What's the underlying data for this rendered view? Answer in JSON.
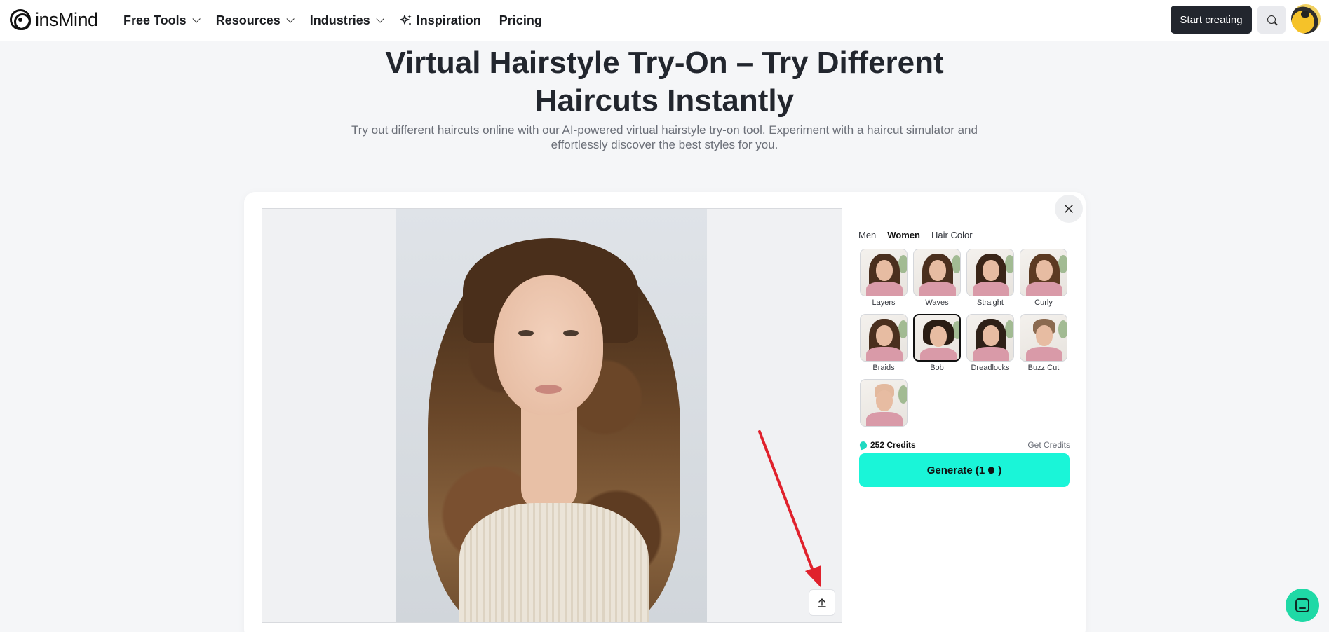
{
  "nav": {
    "brand": "insMind",
    "links": [
      {
        "label": "Free Tools",
        "has_dropdown": true
      },
      {
        "label": "Resources",
        "has_dropdown": true
      },
      {
        "label": "Industries",
        "has_dropdown": true
      },
      {
        "label": "Inspiration",
        "icon": "sparkle-icon"
      },
      {
        "label": "Pricing"
      }
    ],
    "start_button": "Start creating"
  },
  "hero": {
    "title_line1": "Virtual Hairstyle Try-On – Try Different",
    "title_line2": "Haircuts Instantly",
    "subtitle": "Try out different haircuts online with our AI-powered virtual hairstyle try-on tool. Experiment with a haircut simulator and effortlessly discover the best styles for you."
  },
  "panel": {
    "tabs": [
      {
        "label": "Men",
        "active": false
      },
      {
        "label": "Women",
        "active": true
      },
      {
        "label": "Hair Color",
        "active": false
      }
    ],
    "styles": [
      {
        "label": "Layers",
        "selected": false
      },
      {
        "label": "Waves",
        "selected": false
      },
      {
        "label": "Straight",
        "selected": false
      },
      {
        "label": "Curly",
        "selected": false
      },
      {
        "label": "Braids",
        "selected": false
      },
      {
        "label": "Bob",
        "selected": true
      },
      {
        "label": "Dreadlocks",
        "selected": false
      },
      {
        "label": "Buzz Cut",
        "selected": false
      },
      {
        "label": "",
        "selected": false
      }
    ],
    "credits": "252 Credits",
    "get_credits": "Get Credits",
    "generate_label": "Generate (1",
    "generate_suffix": ")"
  },
  "colors": {
    "accent": "#1af5d8",
    "arrow": "#e0212c",
    "dark_button": "#22262e"
  }
}
